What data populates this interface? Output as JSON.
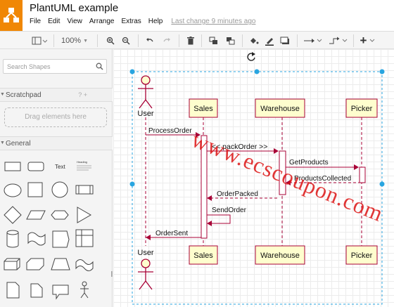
{
  "app": {
    "title": "PlantUML example",
    "last_change": "Last change 9 minutes ago"
  },
  "menu": [
    "File",
    "Edit",
    "View",
    "Arrange",
    "Extras",
    "Help"
  ],
  "toolbar": {
    "zoom": "100%",
    "plus": "+"
  },
  "sidebar": {
    "search_placeholder": "Search Shapes",
    "scratchpad": "Scratchpad",
    "scratch_help": "? +",
    "drag_hint": "Drag elements here",
    "general": "General",
    "text_shape": "Text",
    "heading_shape": "Heading"
  },
  "diagram": {
    "participants": {
      "user": "User",
      "sales": "Sales",
      "warehouse": "Warehouse",
      "picker": "Picker"
    },
    "messages": {
      "process_order": "ProcessOrder",
      "pack_order": "<< packOrder >>",
      "get_products": "GetProducts",
      "products_collected": "ProductsCollected",
      "order_packed": "OrderPacked",
      "send_order": "SendOrder",
      "order_sent": "OrderSent"
    },
    "colors": {
      "lifeline": "#a80036",
      "participant_fill": "#fefece",
      "selection": "#29a5e0",
      "accent": "#f08705"
    }
  },
  "watermark": "www.ecscoupon.com"
}
